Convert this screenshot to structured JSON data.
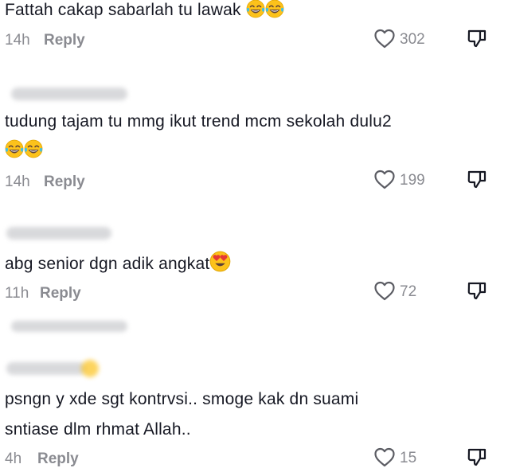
{
  "comments": [
    {
      "text": "Fattah cakap sabarlah tu lawak",
      "emojis": [
        "face-with-tears-of-joy",
        "face-with-tears-of-joy"
      ],
      "time": "14h",
      "reply_label": "Reply",
      "likes": "302"
    },
    {
      "text_line1": "tudung tajam tu mmg ikut trend mcm sekolah dulu2",
      "emojis": [
        "face-with-tears-of-joy",
        "face-with-tears-of-joy"
      ],
      "time": "14h",
      "reply_label": "Reply",
      "likes": "199"
    },
    {
      "text": "abg senior dgn adik angkat",
      "emojis": [
        "smiling-face-with-heart-eyes"
      ],
      "time": "11h",
      "reply_label": "Reply",
      "likes": "72"
    },
    {
      "text_line1": "psngn y xde sgt kontrvsi.. smoge kak dn suami",
      "text_line2": "sntiase dlm rhmat Allah..",
      "time": "4h",
      "reply_label": "Reply",
      "likes": "15"
    }
  ],
  "colors": {
    "text": "#161823",
    "meta": "#8a8b91",
    "blurred_username": "#d2d3d6",
    "emoji_face": "#fcc21b"
  }
}
